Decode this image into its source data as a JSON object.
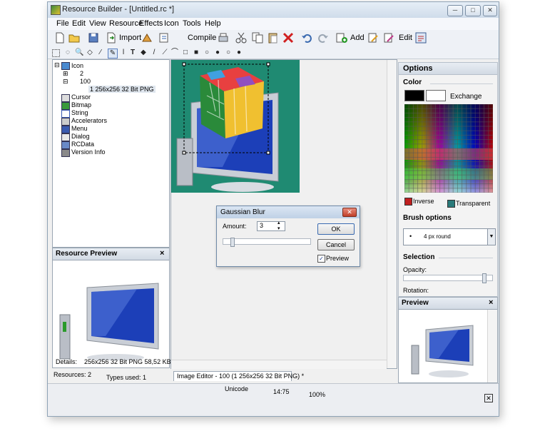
{
  "window": {
    "title": "Resource Builder - [Untitled.rc *]",
    "min_glyph": "─",
    "max_glyph": "□",
    "close_glyph": "✕"
  },
  "menu": [
    "File",
    "Edit",
    "View",
    "Resource",
    "Effects",
    "Icon",
    "Tools",
    "Help"
  ],
  "toolbar": {
    "import_label": "Import",
    "compile_label": "Compile",
    "add_label": "Add",
    "edit_label": "Edit"
  },
  "tree": {
    "root": "Icon",
    "child1": "2",
    "child2": "100",
    "leaf": "1 256x256 32 Bit PNG",
    "items": [
      "Cursor",
      "Bitmap",
      "String",
      "Accelerators",
      "Menu",
      "Dialog",
      "RCData",
      "Version Info"
    ]
  },
  "resource_preview": {
    "title": "Resource Preview",
    "details_label": "Details:",
    "details_value": "256x256 32 Bit PNG 58,52 KB"
  },
  "dialog": {
    "title": "Gaussian Blur",
    "amount_label": "Amount:",
    "amount_value": "3",
    "ok_label": "OK",
    "cancel_label": "Cancel",
    "preview_label": "Preview",
    "preview_checked": true
  },
  "options": {
    "title": "Options",
    "color_label": "Color",
    "exchange_label": "Exchange",
    "inverse_label": "Inverse",
    "transparent_label": "Transparent",
    "brush_title": "Brush options",
    "brush_value": "4 px round",
    "selection_title": "Selection",
    "opacity_label": "Opacity:",
    "rotation_label": "Rotation:"
  },
  "preview_panel": {
    "title": "Preview"
  },
  "editor_tab": {
    "label": "Image Editor - 100 (1 256x256 32 Bit PNG) *"
  },
  "status": {
    "resources": "Resources: 2",
    "types_used": "Types used: 1",
    "encoding": "Unicode",
    "time": "14:75",
    "zoom": "100%"
  },
  "colors": {
    "canvas_bg": "#1f8a72",
    "accent_blue": "#1c3fb8"
  }
}
